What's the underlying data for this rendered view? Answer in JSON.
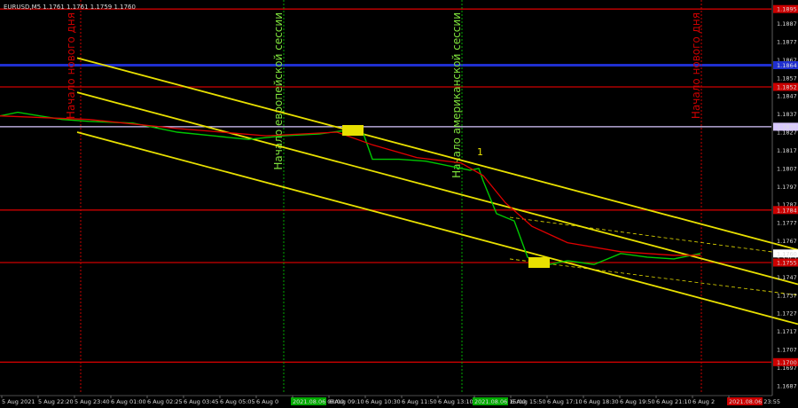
{
  "header": {
    "symbol_line": "EURUSD,M5  1.1761 1.1761 1.1759 1.1760"
  },
  "colors": {
    "background": "#000000",
    "price_line": "#00c800",
    "moving_average": "#e00000",
    "channel": "#e8e000",
    "support_resistance": "#cc0000",
    "key_level": "#1f2fd0",
    "marked_level": "#d8c8ff",
    "session_lines": "#00aa00",
    "day_lines": "#cc0000",
    "annotation_green": "#7ee23c",
    "annotation_red": "#cc0000"
  },
  "annotations": {
    "new_day_left": "Начало нового дня",
    "new_day_right": "Начало нового дня",
    "european_session": "Начало европейской сессии",
    "american_session": "Начало американской сессии",
    "signal_1": "1"
  },
  "chart_data": {
    "type": "line",
    "title": "EURUSD,M5",
    "ohlc_header": {
      "open": 1.1761,
      "high": 1.1761,
      "low": 1.1759,
      "close": 1.176
    },
    "x_tick_labels": [
      "5 Aug 2021",
      "5 Aug 22:20",
      "5 Aug 23:40",
      "6 Aug 01:00",
      "6 Aug 02:25",
      "6 Aug 03:45",
      "6 Aug 05:05",
      "6 Aug 0",
      "2021.08.06 08:00",
      "6 Aug 09:10",
      "6 Aug 10:30",
      "6 Aug 11:50",
      "6 Aug 13:10",
      "2021.08.06 15:00",
      "6 Aug 15:50",
      "6 Aug 17:10",
      "6 Aug 18:30",
      "6 Aug 19:50",
      "6 Aug 21:10",
      "6 Aug 2",
      "2021.08.06 23:55"
    ],
    "y_tick_labels": [
      "1.1887",
      "1.1877",
      "1.1867",
      "1.1857",
      "1.1847",
      "1.1837",
      "1.1827",
      "1.1817",
      "1.1807",
      "1.1797",
      "1.1787",
      "1.1777",
      "1.1767",
      "1.1757",
      "1.1747",
      "1.1737",
      "1.1727",
      "1.1717",
      "1.1707",
      "1.1697",
      "1.1687"
    ],
    "ylim": [
      1.1683,
      1.19
    ],
    "price_labels": [
      "1.1895",
      "1.1864",
      "1.1852",
      "1.1830",
      "1.1784",
      "1.1760",
      "1.1755",
      "1.1700"
    ],
    "horizontal_levels": [
      {
        "price": 1.1895,
        "kind": "support_resistance"
      },
      {
        "price": 1.1864,
        "kind": "key_level"
      },
      {
        "price": 1.1852,
        "kind": "support_resistance"
      },
      {
        "price": 1.183,
        "kind": "marked_level"
      },
      {
        "price": 1.1784,
        "kind": "support_resistance"
      },
      {
        "price": 1.1755,
        "kind": "support_resistance"
      },
      {
        "price": 1.17,
        "kind": "support_resistance"
      }
    ],
    "current_price": 1.176,
    "series": [
      {
        "x": [
          0,
          20,
          45,
          70,
          100,
          150,
          200,
          240,
          280,
          320,
          360,
          390,
          410,
          420,
          450,
          480,
          510,
          530,
          540,
          545,
          560,
          580,
          595,
          610,
          640,
          670,
          700,
          730,
          760,
          790
        ],
        "y": [
          1.1836,
          1.1838,
          1.1836,
          1.1834,
          1.1833,
          1.1832,
          1.1827,
          1.1825,
          1.1823,
          1.1825,
          1.1826,
          1.1828,
          1.1826,
          1.1812,
          1.1812,
          1.1811,
          1.1808,
          1.1806,
          1.1807,
          1.18,
          1.1782,
          1.1778,
          1.1758,
          1.1753,
          1.1756,
          1.1754,
          1.176,
          1.1758,
          1.1757,
          1.176
        ]
      },
      {
        "x": [
          0,
          100,
          200,
          300,
          380,
          420,
          470,
          520,
          545,
          570,
          600,
          640,
          700,
          760,
          790
        ],
        "y": [
          1.1836,
          1.1834,
          1.1829,
          1.1825,
          1.1827,
          1.182,
          1.1813,
          1.181,
          1.1803,
          1.1788,
          1.1775,
          1.1766,
          1.1761,
          1.1759,
          1.1759
        ]
      }
    ],
    "channel_lines": [
      {
        "p1": [
          87,
          1.1868
        ],
        "p2": [
          900,
          1.1762
        ]
      },
      {
        "p1": [
          87,
          1.1849
        ],
        "p2": [
          900,
          1.1743
        ]
      },
      {
        "p1": [
          87,
          1.1827
        ],
        "p2": [
          900,
          1.1721
        ]
      }
    ],
    "signal_boxes": [
      {
        "x": 398,
        "price": 1.1828
      },
      {
        "x": 608,
        "price": 1.1755
      }
    ],
    "vertical_markers": [
      {
        "x": 91,
        "kind": "day"
      },
      {
        "x": 320,
        "kind": "session"
      },
      {
        "x": 521,
        "kind": "session"
      },
      {
        "x": 791,
        "kind": "day"
      }
    ],
    "grid": false
  }
}
